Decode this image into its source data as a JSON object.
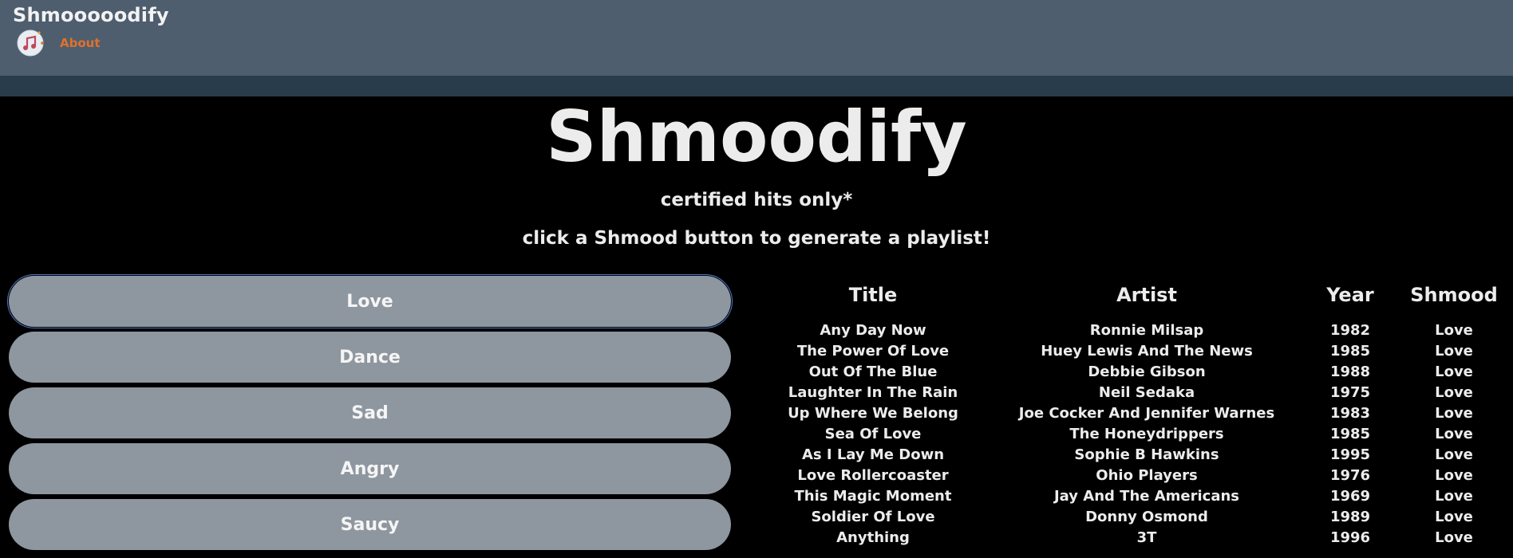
{
  "nav": {
    "brand": "Shmooooodify",
    "about": "About",
    "accent": "#e0712c"
  },
  "hero": {
    "title": "Shmoodify",
    "tagline": "certified hits only*",
    "instruction": "click a Shmood button to generate a playlist!"
  },
  "moods": [
    {
      "label": "Love",
      "selected": true
    },
    {
      "label": "Dance",
      "selected": false
    },
    {
      "label": "Sad",
      "selected": false
    },
    {
      "label": "Angry",
      "selected": false
    },
    {
      "label": "Saucy",
      "selected": false
    }
  ],
  "playlist": {
    "headers": {
      "title": "Title",
      "artist": "Artist",
      "year": "Year",
      "shmood": "Shmood"
    },
    "rows": [
      {
        "title": "Any Day Now",
        "artist": "Ronnie Milsap",
        "year": "1982",
        "shmood": "Love"
      },
      {
        "title": "The Power Of Love",
        "artist": "Huey Lewis And The News",
        "year": "1985",
        "shmood": "Love"
      },
      {
        "title": "Out Of The Blue",
        "artist": "Debbie Gibson",
        "year": "1988",
        "shmood": "Love"
      },
      {
        "title": "Laughter In The Rain",
        "artist": "Neil Sedaka",
        "year": "1975",
        "shmood": "Love"
      },
      {
        "title": "Up Where We Belong",
        "artist": "Joe Cocker And Jennifer Warnes",
        "year": "1983",
        "shmood": "Love"
      },
      {
        "title": "Sea Of Love",
        "artist": "The Honeydrippers",
        "year": "1985",
        "shmood": "Love"
      },
      {
        "title": "As I Lay Me Down",
        "artist": "Sophie B Hawkins",
        "year": "1995",
        "shmood": "Love"
      },
      {
        "title": "Love Rollercoaster",
        "artist": "Ohio Players",
        "year": "1976",
        "shmood": "Love"
      },
      {
        "title": "This Magic Moment",
        "artist": "Jay And The Americans",
        "year": "1969",
        "shmood": "Love"
      },
      {
        "title": "Soldier Of Love",
        "artist": "Donny Osmond",
        "year": "1989",
        "shmood": "Love"
      },
      {
        "title": "Anything",
        "artist": "3T",
        "year": "1996",
        "shmood": "Love"
      }
    ]
  }
}
